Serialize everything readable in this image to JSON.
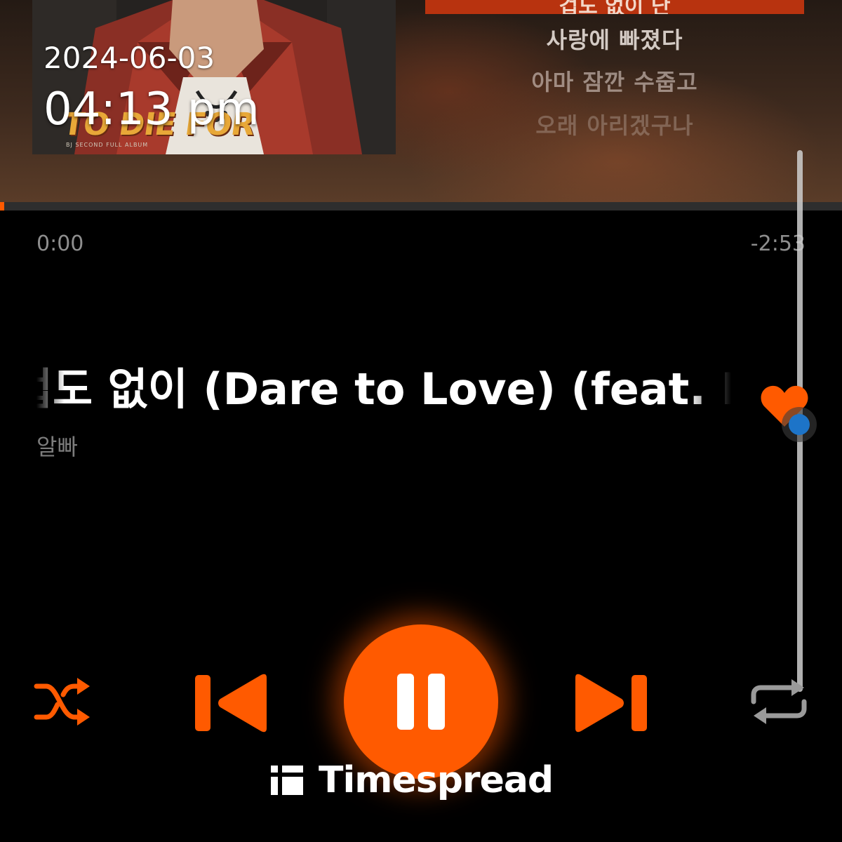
{
  "overlay": {
    "date": "2024-06-03",
    "time": "04:13 pm"
  },
  "album": {
    "art_title": "TO DIE FOR",
    "art_subtitle": "BJ SECOND FULL ALBUM"
  },
  "lyrics": {
    "current_line": "겁도 없이 난",
    "lines": [
      "사랑에 빠졌다",
      "아마 잠깐 수줍고",
      "오래 아리겠구나"
    ]
  },
  "playback": {
    "elapsed": "0:00",
    "remaining": "-2:53",
    "progress_fraction": 0.0
  },
  "track": {
    "title": "겁도 없이 (Dare to Love) (feat. BIG Naughty)",
    "artist": "알빠"
  },
  "controls": {
    "shuffle_icon": "shuffle-icon",
    "prev_icon": "skip-previous-icon",
    "play_state": "playing",
    "pause_icon": "pause-icon",
    "next_icon": "skip-next-icon",
    "repeat_icon": "repeat-icon"
  },
  "watermark": {
    "text": "Timespread"
  },
  "colors": {
    "accent": "#ff5a00",
    "background": "#000000",
    "text_secondary": "#8e8e8e",
    "lyric_highlight": "#b8330f",
    "scroll_dot": "#1d74c8"
  }
}
